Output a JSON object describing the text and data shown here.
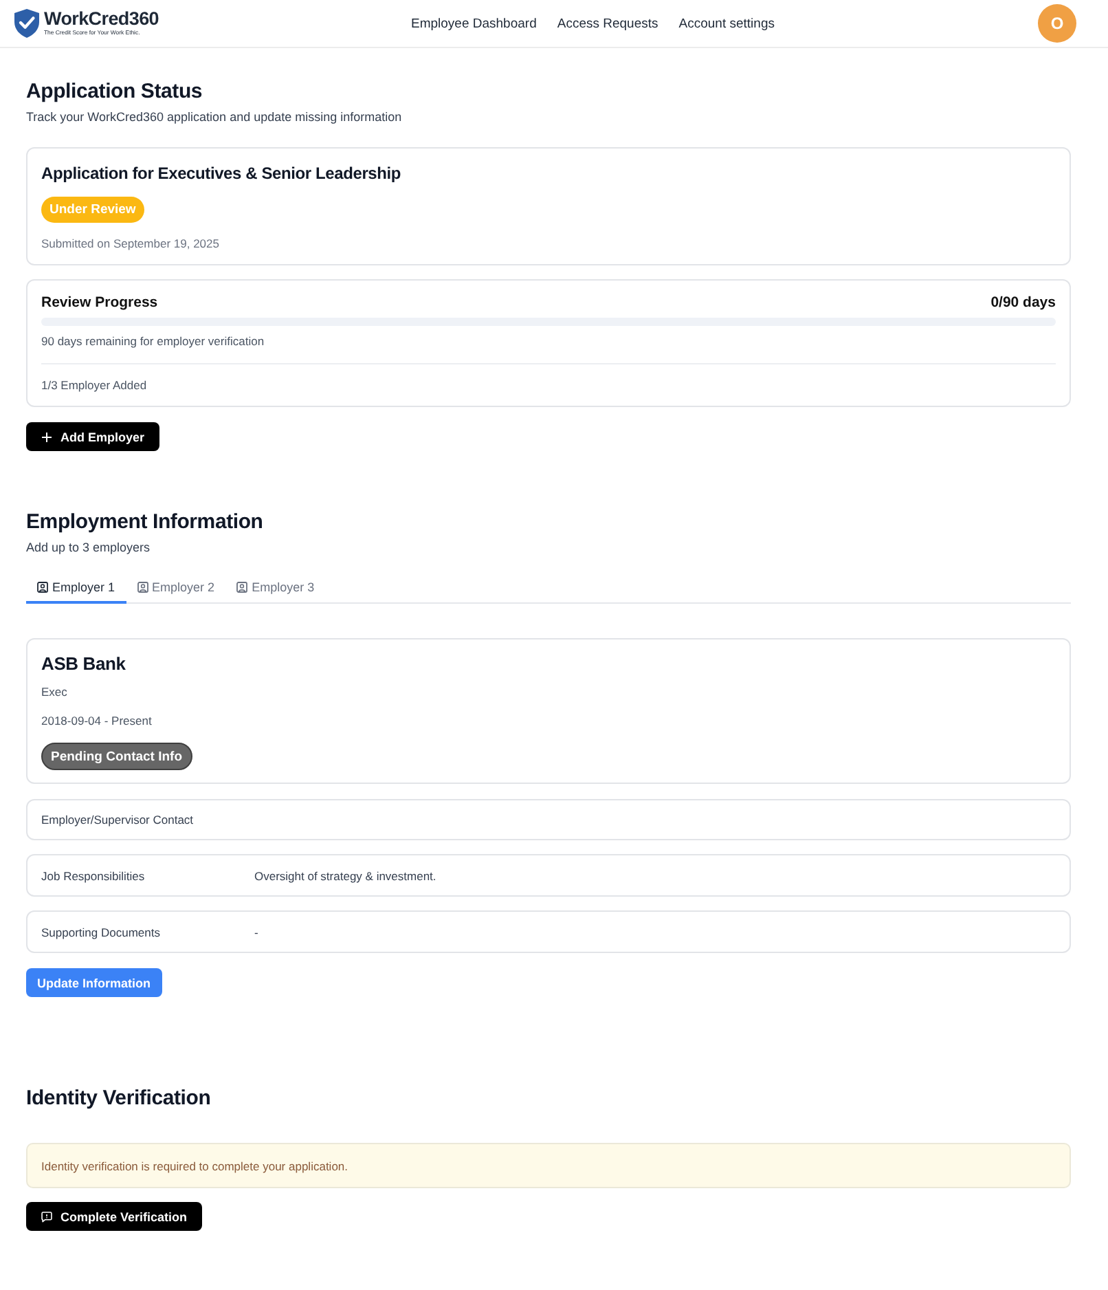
{
  "header": {
    "logo": {
      "name": "WorkCred360",
      "tagline": "The Credit Score for Your Work Ethic."
    },
    "nav": [
      "Employee Dashboard",
      "Access Requests",
      "Account settings"
    ],
    "avatar": "O"
  },
  "application_status": {
    "title": "Application Status",
    "subtitle": "Track your WorkCred360 application and update missing information",
    "application": {
      "title": "Application for Executives & Senior Leadership",
      "status": "Under Review",
      "submitted": "Submitted on September 19, 2025"
    },
    "review_progress": {
      "title": "Review Progress",
      "days": "0/90 days",
      "level": 0,
      "remaining": "90 days remaining for employer verification",
      "employers_added": "1/3 Employer Added"
    },
    "add_button": "Add Employer"
  },
  "employment": {
    "title": "Employment Information",
    "subtitle": "Add up to 3 employers",
    "tabs": [
      {
        "label": "Employer 1",
        "selected": true
      },
      {
        "label": "Employer 2",
        "selected": false
      },
      {
        "label": "Employer 3",
        "selected": false
      }
    ],
    "employer": {
      "name": "ASB Bank",
      "role": "Exec",
      "dates": "2018-09-04 - Present",
      "status": "Pending Contact Info"
    },
    "details": [
      {
        "label": "Employer/Supervisor Contact"
      },
      {
        "label": "Job Responsibilities",
        "value": "Oversight of strategy & investment."
      },
      {
        "label": "Supporting Documents",
        "value": "-"
      }
    ],
    "update_button": "Update Information"
  },
  "identity": {
    "title": "Identity Verification",
    "alert": "Identity verification is required to complete your application.",
    "button": "Complete Verification"
  }
}
